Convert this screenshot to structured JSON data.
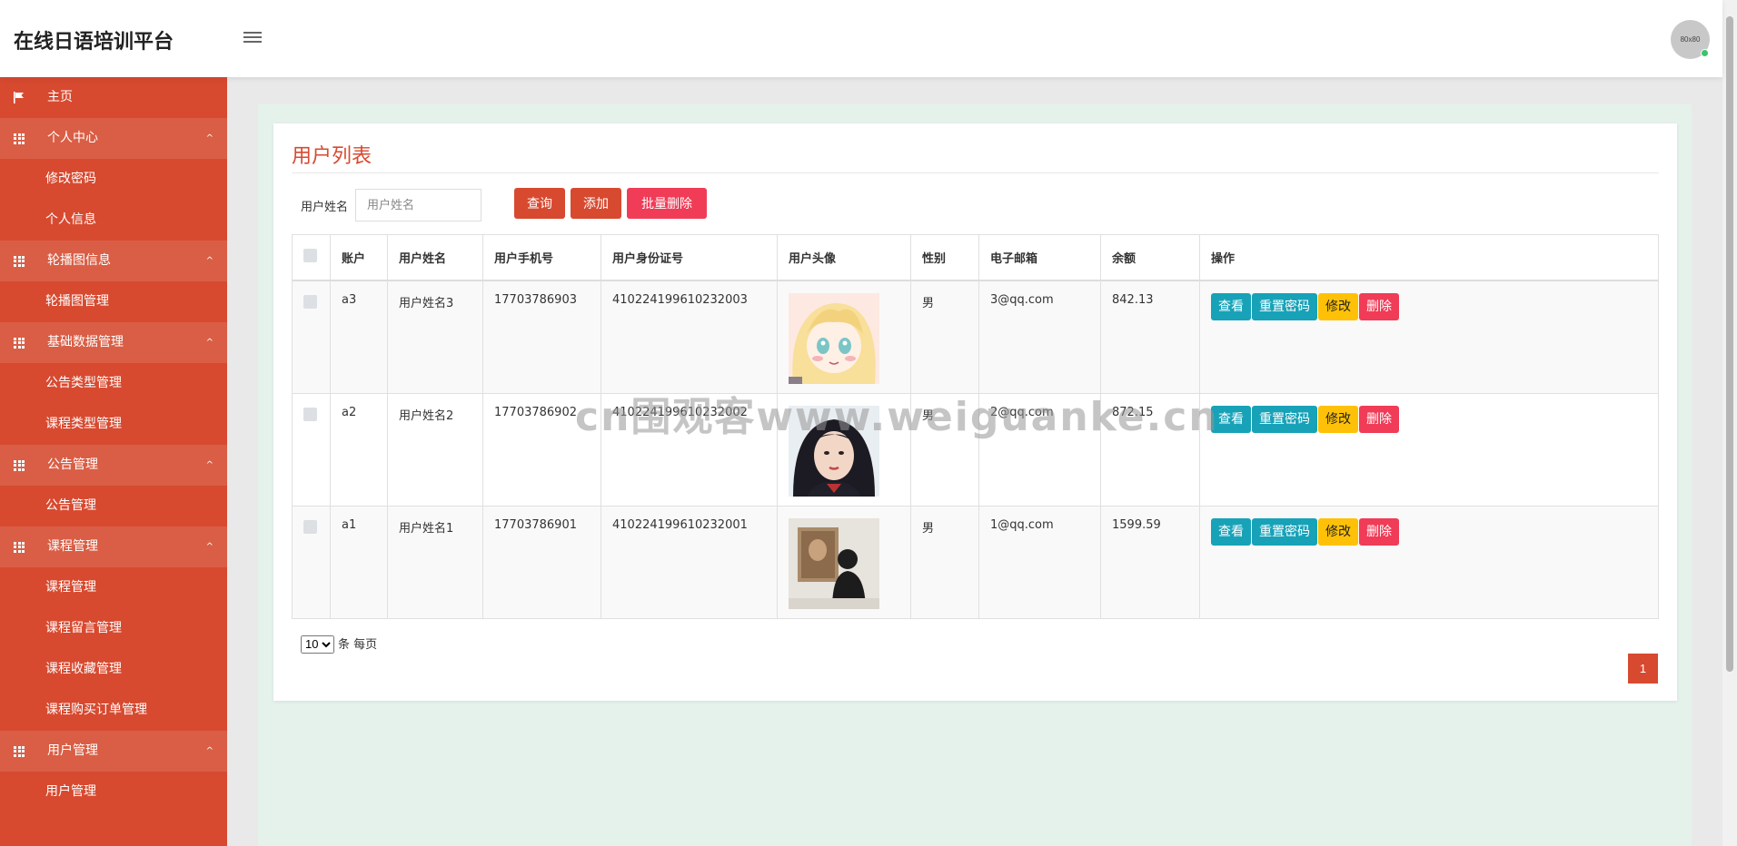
{
  "header": {
    "brand": "在线日语培训平台",
    "avatar_text": "80x80"
  },
  "sidebar": {
    "items": [
      {
        "label": "主页",
        "type": "home",
        "icon": "flag-icon"
      },
      {
        "label": "个人中心",
        "type": "group",
        "icon": "grid-icon"
      },
      {
        "label": "修改密码",
        "type": "sub"
      },
      {
        "label": "个人信息",
        "type": "sub"
      },
      {
        "label": "轮播图信息",
        "type": "group",
        "icon": "grid-icon"
      },
      {
        "label": "轮播图管理",
        "type": "sub"
      },
      {
        "label": "基础数据管理",
        "type": "group",
        "icon": "grid-icon"
      },
      {
        "label": "公告类型管理",
        "type": "sub"
      },
      {
        "label": "课程类型管理",
        "type": "sub"
      },
      {
        "label": "公告管理",
        "type": "group",
        "icon": "grid-icon"
      },
      {
        "label": "公告管理",
        "type": "sub"
      },
      {
        "label": "课程管理",
        "type": "group",
        "icon": "grid-icon"
      },
      {
        "label": "课程管理",
        "type": "sub"
      },
      {
        "label": "课程留言管理",
        "type": "sub"
      },
      {
        "label": "课程收藏管理",
        "type": "sub"
      },
      {
        "label": "课程购买订单管理",
        "type": "sub"
      },
      {
        "label": "用户管理",
        "type": "group",
        "icon": "grid-icon"
      },
      {
        "label": "用户管理",
        "type": "sub"
      }
    ],
    "caret": "^"
  },
  "main": {
    "title": "用户列表",
    "search": {
      "label": "用户姓名",
      "placeholder": "用户姓名",
      "value": ""
    },
    "buttons": {
      "query": "查询",
      "add": "添加",
      "batch_delete": "批量删除"
    },
    "table": {
      "columns": [
        "账户",
        "用户姓名",
        "用户手机号",
        "用户身份证号",
        "用户头像",
        "性别",
        "电子邮箱",
        "余额",
        "操作"
      ],
      "rows": [
        {
          "account": "a3",
          "name": "用户姓名3",
          "phone": "17703786903",
          "id_card": "410224199610232003",
          "avatar": "anime-girl",
          "gender": "男",
          "email": "3@qq.com",
          "balance": "842.13"
        },
        {
          "account": "a2",
          "name": "用户姓名2",
          "phone": "17703786902",
          "id_card": "410224199610232002",
          "avatar": "girl-portrait",
          "gender": "男",
          "email": "2@qq.com",
          "balance": "872.15"
        },
        {
          "account": "a1",
          "name": "用户姓名1",
          "phone": "17703786901",
          "id_card": "410224199610232001",
          "avatar": "person-gallery",
          "gender": "男",
          "email": "1@qq.com",
          "balance": "1599.59"
        }
      ],
      "actions": {
        "view": "查看",
        "reset": "重置密码",
        "edit": "修改",
        "delete": "删除"
      }
    },
    "pagination": {
      "page_size": "10",
      "page_size_options": [
        "10"
      ],
      "page_size_suffix": "条 每页",
      "current_page": "1"
    }
  },
  "watermark": "cn围观客www.weiguanke.cn",
  "colors": {
    "primary": "#d74a30",
    "info": "#17a2b8",
    "warning": "#ffc107",
    "danger": "#f03c57",
    "content_bg": "#e5f2ec"
  }
}
